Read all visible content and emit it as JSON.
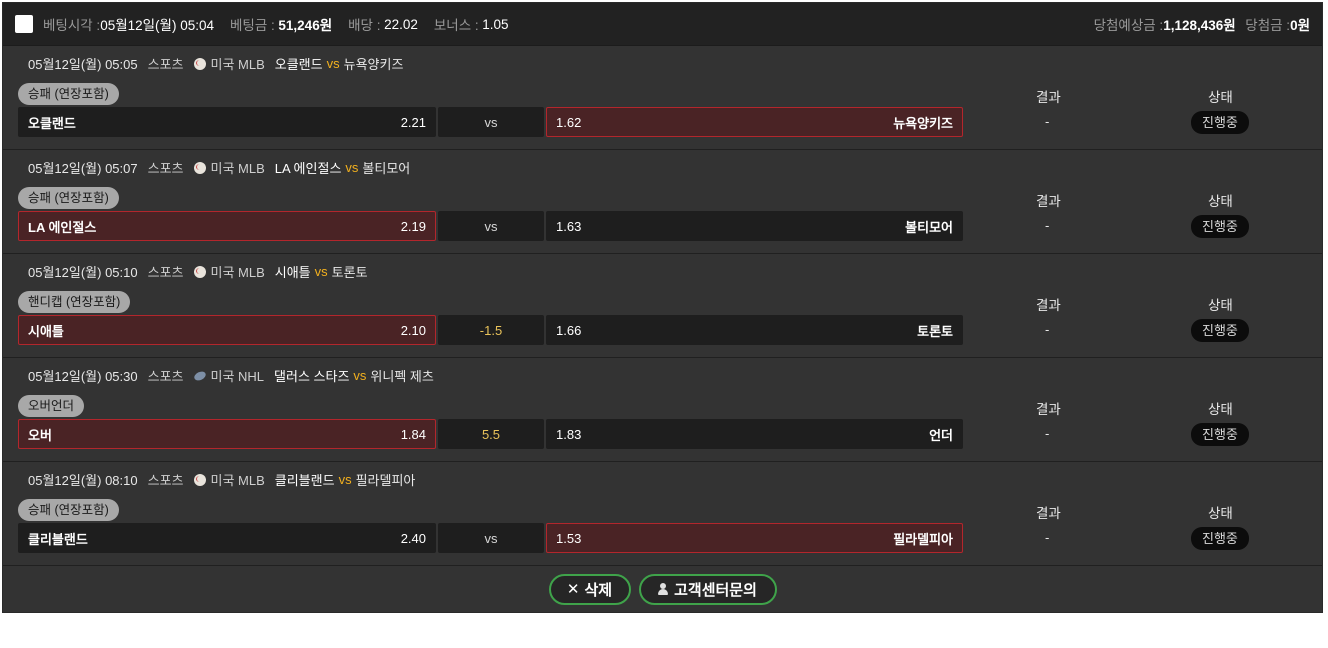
{
  "header": {
    "bet_time_label": "베팅시각 :",
    "bet_time": "05월12일(월) 05:04",
    "bet_amount_label": "베팅금 :",
    "bet_amount": "51,246원",
    "odds_label": "배당 :",
    "odds": "22.02",
    "bonus_label": "보너스 :",
    "bonus": "1.05",
    "expected_label": "당첨예상금 :",
    "expected": "1,128,436원",
    "win_label": "당첨금 :",
    "win": "0원"
  },
  "games": [
    {
      "datetime": "05월12일(월) 05:05",
      "sport": "스포츠",
      "sport_icon": "baseball-icon",
      "league": "미국 MLB",
      "home": "오클랜드",
      "vs": "vs",
      "away": "뉴욕양키즈",
      "bet_type": "승패 (연장포함)",
      "home_odds": "2.21",
      "mid": "vs",
      "away_odds": "1.62",
      "selected": "away",
      "result_label": "결과",
      "result": "-",
      "status_label": "상태",
      "status": "진행중"
    },
    {
      "datetime": "05월12일(월) 05:07",
      "sport": "스포츠",
      "sport_icon": "baseball-icon",
      "league": "미국 MLB",
      "home": "LA 에인절스",
      "vs": "vs",
      "away": "볼티모어",
      "bet_type": "승패 (연장포함)",
      "home_odds": "2.19",
      "mid": "vs",
      "away_odds": "1.63",
      "selected": "home",
      "result_label": "결과",
      "result": "-",
      "status_label": "상태",
      "status": "진행중"
    },
    {
      "datetime": "05월12일(월) 05:10",
      "sport": "스포츠",
      "sport_icon": "baseball-icon",
      "league": "미국 MLB",
      "home": "시애틀",
      "vs": "vs",
      "away": "토론토",
      "bet_type": "핸디캡 (연장포함)",
      "home_odds": "2.10",
      "mid": "-1.5",
      "away_odds": "1.66",
      "selected": "home",
      "result_label": "결과",
      "result": "-",
      "status_label": "상태",
      "status": "진행중"
    },
    {
      "datetime": "05월12일(월) 05:30",
      "sport": "스포츠",
      "sport_icon": "hockey-puck-icon",
      "league": "미국 NHL",
      "home": "댈러스 스타즈",
      "vs": "vs",
      "away": "위니펙 제츠",
      "bet_type": "오버언더",
      "home_label": "오버",
      "home_odds": "1.84",
      "mid": "5.5",
      "away_label": "언더",
      "away_odds": "1.83",
      "selected": "home",
      "result_label": "결과",
      "result": "-",
      "status_label": "상태",
      "status": "진행중"
    },
    {
      "datetime": "05월12일(월) 08:10",
      "sport": "스포츠",
      "sport_icon": "baseball-icon",
      "league": "미국 MLB",
      "home": "클리블랜드",
      "vs": "vs",
      "away": "필라델피아",
      "bet_type": "승패 (연장포함)",
      "home_odds": "2.40",
      "mid": "vs",
      "away_odds": "1.53",
      "selected": "away",
      "result_label": "결과",
      "result": "-",
      "status_label": "상태",
      "status": "진행중"
    }
  ],
  "footer": {
    "delete_icon": "close-icon",
    "delete_label": "삭제",
    "support_icon": "person-icon",
    "support_label": "고객센터문의"
  },
  "colors": {
    "panel": "#333333",
    "header": "#222222",
    "selected_bg": "#4a2325",
    "selected_border": "#b3262c",
    "vs_accent": "#f2b01e",
    "button_border": "#3fa34a"
  }
}
